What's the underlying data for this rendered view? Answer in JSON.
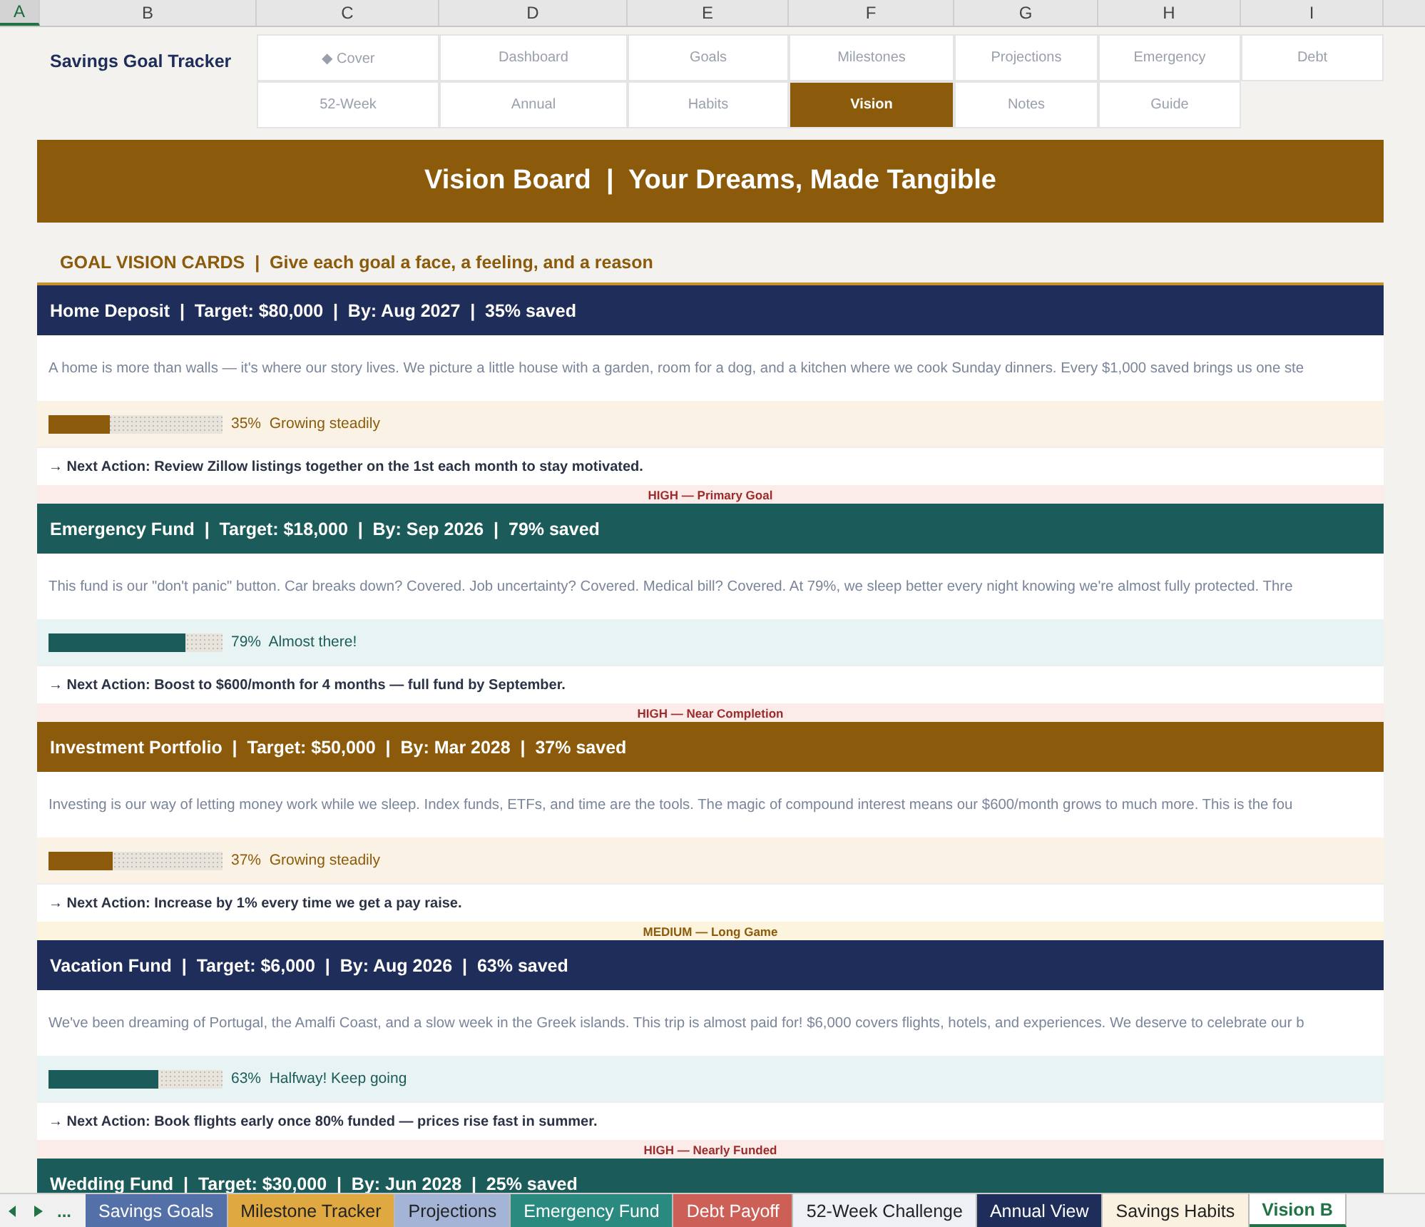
{
  "columns": [
    {
      "label": "A",
      "selected": true
    },
    {
      "label": "B",
      "selected": false
    },
    {
      "label": "C",
      "selected": false
    },
    {
      "label": "D",
      "selected": false
    },
    {
      "label": "E",
      "selected": false
    },
    {
      "label": "F",
      "selected": false
    },
    {
      "label": "G",
      "selected": false
    },
    {
      "label": "H",
      "selected": false
    },
    {
      "label": "I",
      "selected": false
    }
  ],
  "title": "Savings Goal Tracker",
  "nav": [
    [
      {
        "label": "◆ Cover",
        "selected": false
      },
      {
        "label": "Dashboard",
        "selected": false
      },
      {
        "label": "Goals",
        "selected": false
      },
      {
        "label": "Milestones",
        "selected": false
      },
      {
        "label": "Projections",
        "selected": false
      },
      {
        "label": "Emergency",
        "selected": false
      },
      {
        "label": "Debt",
        "selected": false
      }
    ],
    [
      {
        "label": "52-Week",
        "selected": false
      },
      {
        "label": "Annual",
        "selected": false
      },
      {
        "label": "Habits",
        "selected": false
      },
      {
        "label": "Vision",
        "selected": true
      },
      {
        "label": "Notes",
        "selected": false
      },
      {
        "label": "Guide",
        "selected": false
      }
    ]
  ],
  "banner": "Vision Board  |  Your Dreams, Made Tangible",
  "section_heading": "GOAL VISION CARDS  |  Give each goal a face, a feeling, and a reason",
  "cards": [
    {
      "header": "Home Deposit  |  Target: $80,000  |  By: Aug 2027  |  35% saved",
      "color": "#1e2d5a",
      "description": "A home is more than walls — it's where our story lives. We picture a little house with a garden, room for a dog, and a kitchen where we cook Sunday dinners. Every $1,000 saved brings us one ste",
      "progress": {
        "level": 0.35,
        "color": "#8b5a0a",
        "reading": "35%  Growing steadily"
      },
      "action": "→ Next Action: Review Zillow listings together on the 1st each month to stay motivated.",
      "priority": {
        "text": "HIGH — Primary Goal",
        "kind": "high"
      }
    },
    {
      "header": "Emergency Fund  |  Target: $18,000  |  By: Sep 2026  |  79% saved",
      "color": "#1b5c5a",
      "description": "This fund is our \"don't panic\" button. Car breaks down? Covered. Job uncertainty? Covered. Medical bill? Covered. At 79%, we sleep better every night knowing we're almost fully protected. Thre",
      "progress": {
        "level": 0.79,
        "color": "#1b5c5a",
        "reading": "79%  Almost there!"
      },
      "action": "→ Next Action: Boost to $600/month for 4 months — full fund by September.",
      "priority": {
        "text": "HIGH — Near Completion",
        "kind": "high"
      }
    },
    {
      "header": "Investment Portfolio  |  Target: $50,000  |  By: Mar 2028  |  37% saved",
      "color": "#8b5a0a",
      "description": "Investing is our way of letting money work while we sleep. Index funds, ETFs, and time are the tools. The magic of compound interest means our $600/month grows to much more. This is the fou",
      "progress": {
        "level": 0.37,
        "color": "#8b5a0a",
        "reading": "37%  Growing steadily"
      },
      "action": "→ Next Action: Increase by 1% every time we get a pay raise.",
      "priority": {
        "text": "MEDIUM — Long Game",
        "kind": "medium"
      }
    },
    {
      "header": "Vacation Fund  |  Target: $6,000  |  By: Aug 2026  |  63% saved",
      "color": "#1e2d5a",
      "description": "We've been dreaming of Portugal, the Amalfi Coast, and a slow week in the Greek islands. This trip is almost paid for! $6,000 covers flights, hotels, and experiences. We deserve to celebrate our b",
      "progress": {
        "level": 0.63,
        "color": "#1b5c5a",
        "reading": "63%  Halfway! Keep going"
      },
      "action": "→ Next Action: Book flights early once 80% funded — prices rise fast in summer.",
      "priority": {
        "text": "HIGH — Nearly Funded",
        "kind": "high"
      }
    },
    {
      "header": "Wedding Fund  |  Target: $30,000  |  By: Jun 2028  |  25% saved",
      "color": "#1b5c5a"
    }
  ],
  "sheet_tabs": [
    {
      "label": "Savings Goals",
      "color": "#5470a8",
      "selected": false
    },
    {
      "label": "Milestone Tracker",
      "color": "#e0a840",
      "selected": false
    },
    {
      "label": "Projections",
      "color": "#a3b4d6",
      "selected": false
    },
    {
      "label": "Emergency Fund",
      "color": "#2a8a80",
      "selected": false
    },
    {
      "label": "Debt Payoff",
      "color": "#cc5f56",
      "selected": false
    },
    {
      "label": "52-Week Challenge",
      "color": "#eef0f6",
      "selected": false
    },
    {
      "label": "Annual View",
      "color": "#1e2d5a",
      "selected": false
    },
    {
      "label": "Savings Habits",
      "color": "#faf1e0",
      "selected": false
    },
    {
      "label": "Vision B",
      "color": "#ffffff",
      "selected": true
    }
  ],
  "tab_overflow": "..."
}
